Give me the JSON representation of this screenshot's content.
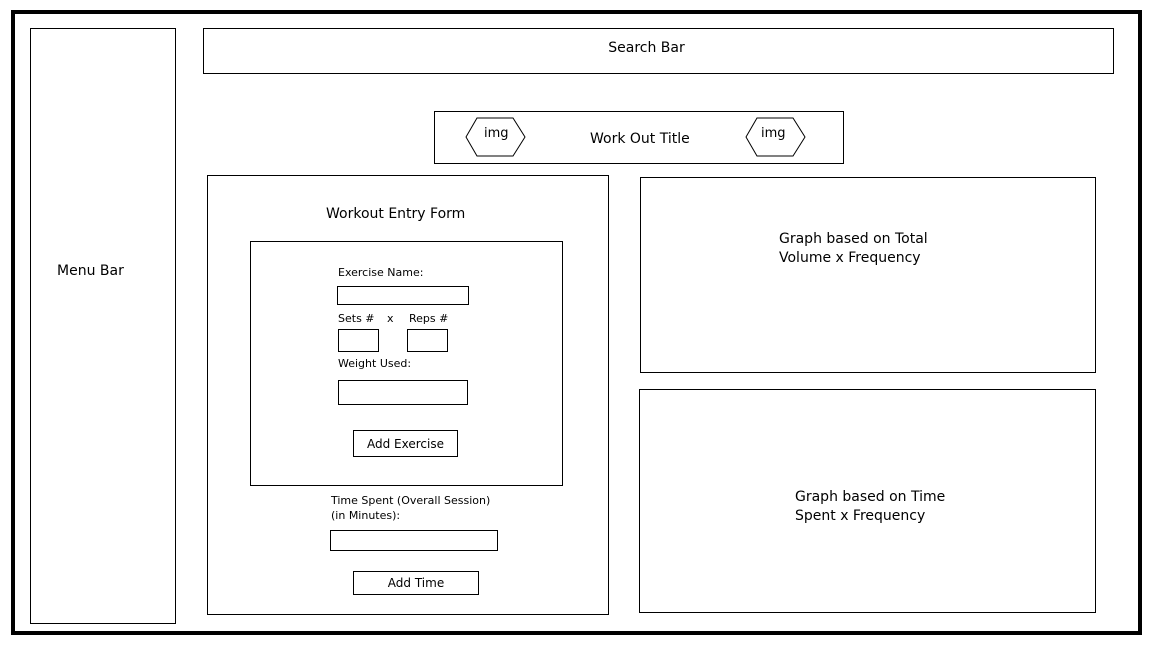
{
  "menu_bar": {
    "label": "Menu Bar"
  },
  "search_bar": {
    "label": "Search Bar"
  },
  "header": {
    "title": "Work Out Title",
    "left_img_label": "img",
    "right_img_label": "img"
  },
  "form": {
    "title": "Workout Entry Form",
    "exercise_name_label": "Exercise Name:",
    "sets_label": "Sets #",
    "times_label": "x",
    "reps_label": "Reps #",
    "weight_label": "Weight Used:",
    "add_exercise_label": "Add Exercise",
    "time_spent_label_line1": "Time Spent (Overall Session)",
    "time_spent_label_line2": "(in Minutes):",
    "add_time_label": "Add Time"
  },
  "graphs": {
    "volume_line1": "Graph based on Total",
    "volume_line2": "Volume x Frequency",
    "time_line1": "Graph based on Time",
    "time_line2": "Spent x Frequency"
  }
}
